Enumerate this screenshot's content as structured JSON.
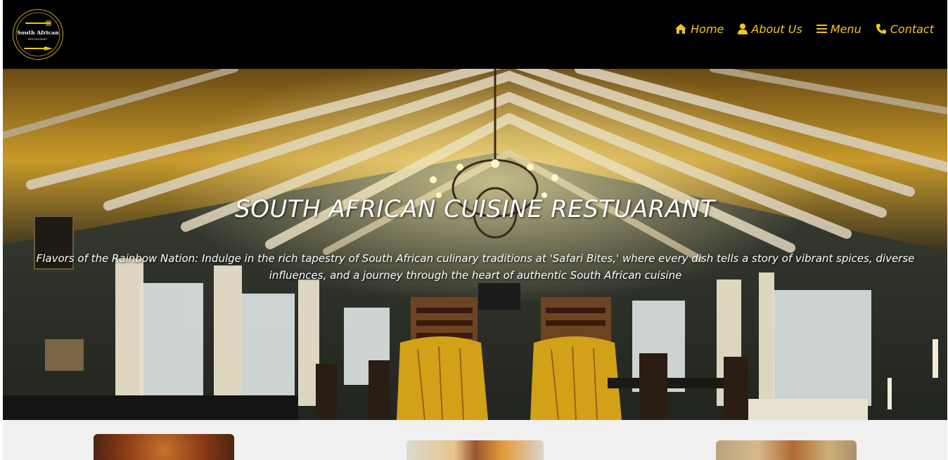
{
  "brand": {
    "logo_title": "South African",
    "logo_subtitle": "RESTAURANT"
  },
  "nav": {
    "items": [
      {
        "label": "Home",
        "icon": "home-icon"
      },
      {
        "label": "About Us",
        "icon": "user-icon"
      },
      {
        "label": "Menu",
        "icon": "menu-icon"
      },
      {
        "label": "Contact",
        "icon": "phone-icon"
      }
    ]
  },
  "hero": {
    "title": "SOUTH AFRICAN CUISINE RESTUARANT",
    "subtitle": "Flavors of the Rainbow Nation: Indulge in the rich tapestry of South African culinary traditions at 'Safari Bites,' where every dish tells a story of vibrant spices, diverse influences, and a journey through the heart of authentic South African cuisine"
  },
  "colors": {
    "header_bg": "#000000",
    "nav_accent": "#f5c518",
    "logo_ring": "#c9a227",
    "page_bg": "#f0f0f0"
  }
}
